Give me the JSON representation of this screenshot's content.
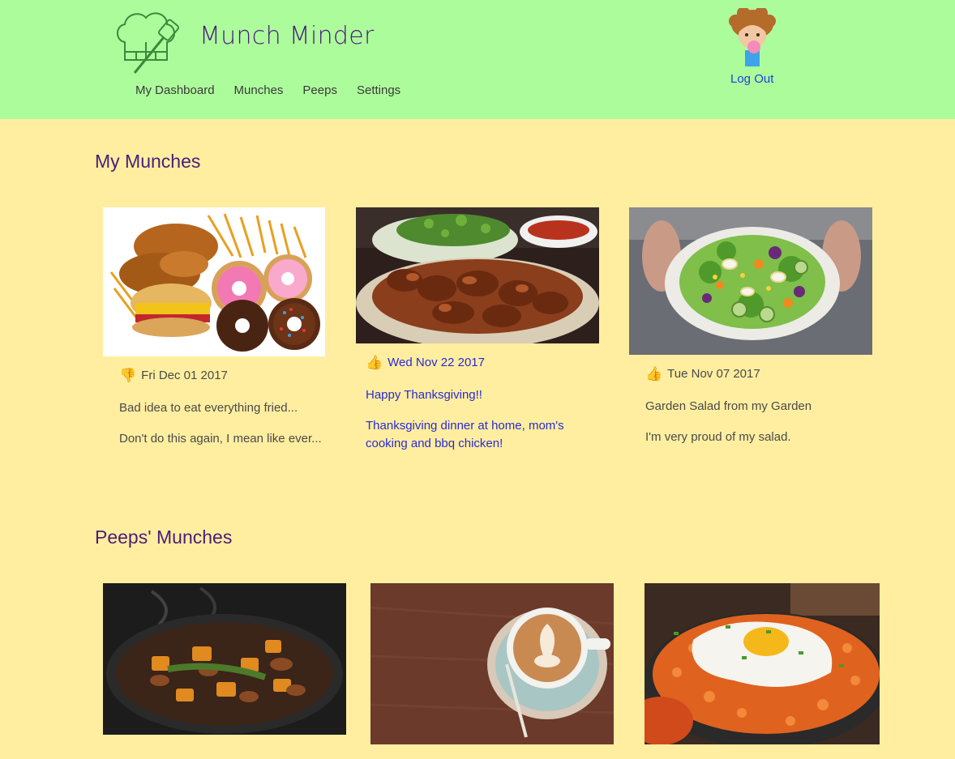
{
  "header": {
    "app_title": "Munch Minder",
    "nav": [
      "My Dashboard",
      "Munches",
      "Peeps",
      "Settings"
    ],
    "logout_label": "Log Out",
    "background_color": "#adfc9c"
  },
  "page": {
    "background_color": "#ffeea0",
    "accent_color": "#4b1d7a",
    "link_color": "#2a2ad6"
  },
  "my_munches": {
    "heading": "My Munches",
    "cards": [
      {
        "thumb": "thumbs-down-icon",
        "thumb_glyph": "👎",
        "date": "Fri Dec 01 2017",
        "title": "Bad idea to eat everything fried...",
        "description": "Don't do this again, I mean like ever...",
        "image": "fried-food-and-donuts-photo"
      },
      {
        "thumb": "thumbs-up-icon",
        "thumb_glyph": "👍",
        "date": "Wed Nov 22 2017",
        "title": "Happy Thanksgiving!!",
        "description": "Thanksgiving dinner at home, mom's cooking and bbq chicken!",
        "image": "bbq-chicken-photo"
      },
      {
        "thumb": "thumbs-up-icon",
        "thumb_glyph": "👍",
        "date": "Tue Nov 07 2017",
        "title": "Garden Salad from my Garden",
        "description": "I'm very proud of my salad.",
        "image": "garden-salad-photo"
      }
    ]
  },
  "peeps_munches": {
    "heading": "Peeps' Munches",
    "cards": [
      {
        "image": "pan-stir-fry-photo"
      },
      {
        "image": "latte-art-photo"
      },
      {
        "image": "kimchi-fried-rice-photo"
      }
    ]
  }
}
